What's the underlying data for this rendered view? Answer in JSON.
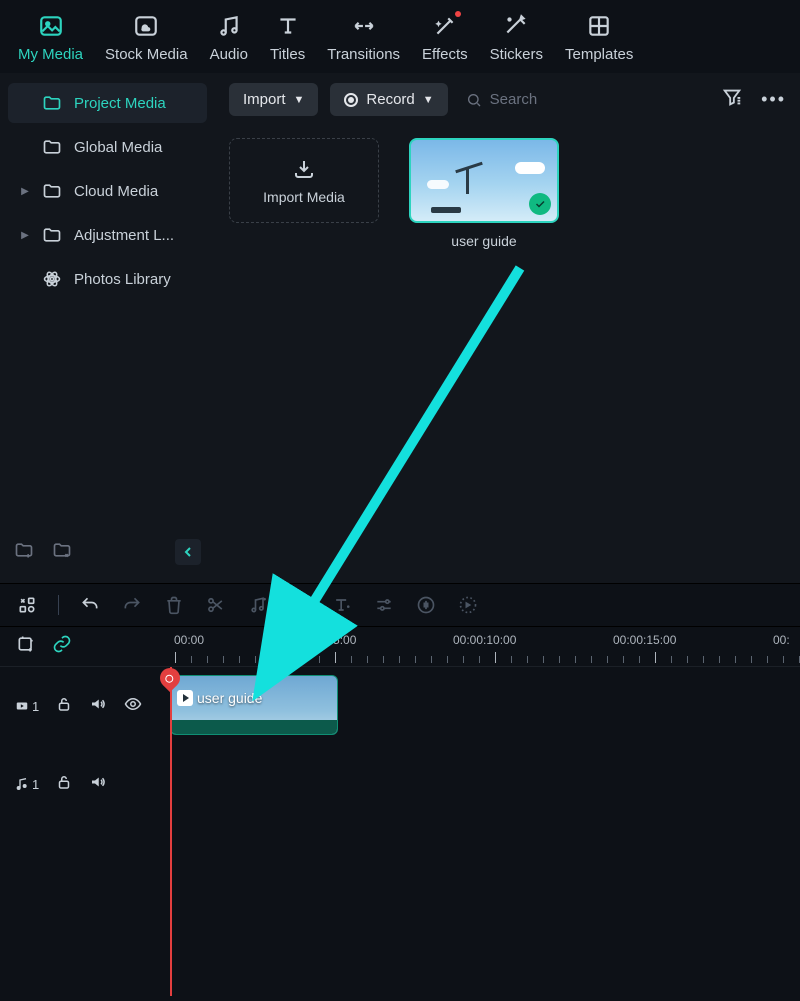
{
  "top_tabs": {
    "my_media": "My Media",
    "stock_media": "Stock Media",
    "audio": "Audio",
    "titles": "Titles",
    "transitions": "Transitions",
    "effects": "Effects",
    "stickers": "Stickers",
    "templates": "Templates"
  },
  "sidebar": {
    "items": [
      {
        "label": "Project Media",
        "expandable": false,
        "active": true,
        "icon": "folder"
      },
      {
        "label": "Global Media",
        "expandable": false,
        "active": false,
        "icon": "folder"
      },
      {
        "label": "Cloud Media",
        "expandable": true,
        "active": false,
        "icon": "folder"
      },
      {
        "label": "Adjustment L...",
        "expandable": true,
        "active": false,
        "icon": "folder"
      },
      {
        "label": "Photos Library",
        "expandable": false,
        "active": false,
        "icon": "atom"
      }
    ]
  },
  "toolbar": {
    "import_label": "Import",
    "record_label": "Record",
    "search_placeholder": "Search"
  },
  "media": {
    "import_tile_label": "Import Media",
    "clip_name": "user guide"
  },
  "timeline": {
    "ruler_marks": [
      "00:00",
      "00:00:05:00",
      "00:00:10:00",
      "00:00:15:00",
      "00:"
    ],
    "video_track_number": "1",
    "audio_track_number": "1",
    "clip_label": "user guide"
  }
}
